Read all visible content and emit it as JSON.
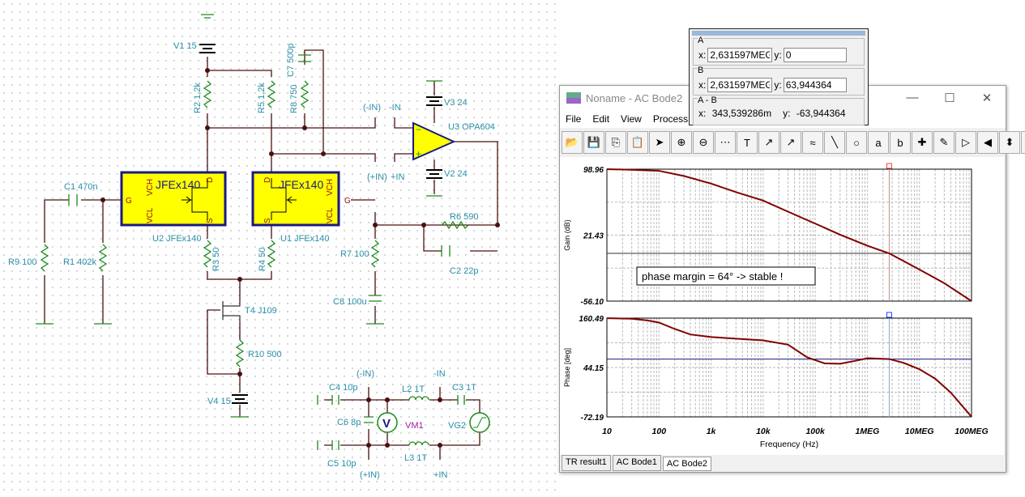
{
  "schematic": {
    "labels": {
      "v1": "V1 15",
      "r2": "R2 1,2k",
      "r5": "R5 1,2k",
      "c7": "C7 500p",
      "r8": "R8 750",
      "nin": "(-IN)",
      "nin2": "-IN",
      "pin": "(+IN)",
      "pin2": "+IN",
      "u3": "U3 OPA604",
      "v3": "V3 24",
      "v2": "V2 24",
      "c1": "C1 470n",
      "u2": "U2 JFEx140",
      "u1": "U1 JFEx140",
      "jfe": "JFEx140",
      "r9": "R9 100",
      "r1": "R1 402k",
      "r3": "R3 50",
      "r4": "R4 50",
      "r7": "R7 100",
      "r6": "R6 590",
      "c2": "C2 22p",
      "c8": "C8 100u",
      "t4": "T4 J109",
      "r10": "R10 500",
      "v4": "V4 15",
      "c4": "C4 10p",
      "c5": "C5 10p",
      "c6": "C6 8p",
      "vm1": "VM1",
      "l2": "L2 1T",
      "l3": "L3 1T",
      "c3": "C3 1T",
      "vg2": "VG2",
      "bnin": "(-IN)",
      "bnin2": "-IN",
      "bpin": "(+IN)",
      "bpin2": "+IN",
      "vm": "V",
      "plus": "+"
    },
    "pins": {
      "vch": "VCH",
      "vcl": "VCL",
      "g": "G",
      "d": "D",
      "s": "S"
    }
  },
  "cursor": {
    "a_label": "A",
    "a_x": "2,631597MEG",
    "a_y": "0",
    "b_label": "B",
    "b_x": "2,631597MEG",
    "b_y": "63,944364",
    "ab_label": "A - B",
    "ab_x": "343,539286m",
    "ab_y": "-63,944364",
    "x_label": "x:",
    "y_label": "y:"
  },
  "window": {
    "title": "Noname - AC Bode2",
    "menu": [
      "File",
      "Edit",
      "View",
      "Process"
    ],
    "toolbar": [
      "open-icon",
      "save-icon",
      "copy-icon",
      "paste-icon",
      "pointer-icon",
      "zoom-in-icon",
      "zoom-100-icon",
      "grid-icon",
      "text-icon",
      "label-icon",
      "curve-label-icon",
      "legend-icon",
      "line-icon",
      "circle-icon",
      "cursor-a-icon",
      "cursor-b-icon",
      "add-curve-icon",
      "pick-color-icon",
      "marker-icon",
      "arrow-left-icon",
      "arrow-updown-icon",
      "arrow-right-icon"
    ],
    "tabs": [
      "TR result1",
      "AC Bode1",
      "AC Bode2"
    ],
    "active_tab": "AC Bode2"
  },
  "chart_data": [
    {
      "type": "line",
      "ylabel": "Gain (dB)",
      "xlabel": "Frequency (Hz)",
      "xscale": "log",
      "xlim": [
        10,
        100000000
      ],
      "ylim": [
        -56.1,
        98.96
      ],
      "yticks": [
        "98.96",
        "21.43",
        "-56.10"
      ],
      "xticks": [
        "10",
        "100",
        "1k",
        "10k",
        "100k",
        "1MEG",
        "10MEG",
        "100MEG"
      ],
      "annotation": "phase margin = 64° -> stable !",
      "color": "#800000",
      "cursor_x": 2631597,
      "cursor_y": 0,
      "x": [
        10,
        30,
        100,
        300,
        1000,
        3000,
        10000,
        30000,
        100000,
        300000,
        1000000,
        2631597,
        10000000,
        30000000,
        100000000
      ],
      "y": [
        98.96,
        98.3,
        97,
        91,
        82,
        72,
        62,
        49,
        35,
        22,
        9,
        0,
        -19,
        -35,
        -56.1
      ]
    },
    {
      "type": "line",
      "ylabel": "Phase [deg]",
      "xlabel": "Frequency (Hz)",
      "xscale": "log",
      "xlim": [
        10,
        100000000
      ],
      "ylim": [
        -72.19,
        160.49
      ],
      "yticks": [
        "160.49",
        "44.15",
        "-72.19"
      ],
      "xticks": [
        "10",
        "100",
        "1k",
        "10k",
        "100k",
        "1MEG",
        "10MEG",
        "100MEG"
      ],
      "color": "#800000",
      "cursor_x": 2631597,
      "cursor_y": 63.94,
      "x": [
        10,
        30,
        60,
        100,
        200,
        400,
        1000,
        3000,
        10000,
        30000,
        70000,
        150000,
        300000,
        600000,
        1000000,
        2631597,
        5000000,
        10000000,
        20000000,
        40000000,
        100000000
      ],
      "y": [
        160.3,
        159,
        155,
        150,
        135,
        122,
        116,
        112,
        108,
        98,
        68,
        54,
        53,
        60,
        66,
        64,
        55,
        40,
        18,
        -15,
        -72
      ]
    }
  ]
}
